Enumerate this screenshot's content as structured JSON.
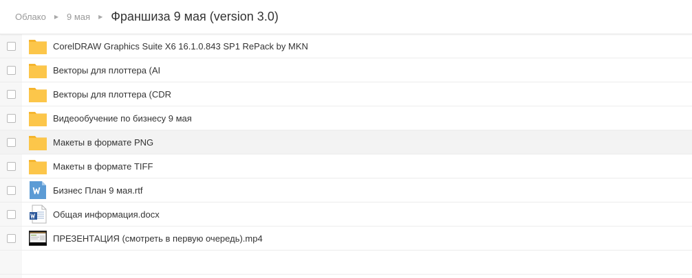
{
  "breadcrumb": {
    "items": [
      "Облако",
      "9 мая"
    ],
    "current": "Франшиза 9 мая (version 3.0)",
    "separator": "▶"
  },
  "files": [
    {
      "name": "CorelDRAW Graphics Suite X6 16.1.0.843 SP1 RePack by MKN",
      "icon": "folder-icon"
    },
    {
      "name": "Векторы для плоттера (AI",
      "icon": "folder-icon"
    },
    {
      "name": "Векторы для плоттера (CDR",
      "icon": "folder-icon"
    },
    {
      "name": "Видеообучение по бизнесу 9 мая",
      "icon": "folder-icon"
    },
    {
      "name": "Макеты в формате PNG",
      "icon": "folder-icon"
    },
    {
      "name": "Макеты в формате TIFF",
      "icon": "folder-icon"
    },
    {
      "name": "Бизнес План 9 мая.rtf",
      "icon": "rtf-file-icon"
    },
    {
      "name": "Общая информация.docx",
      "icon": "docx-file-icon"
    },
    {
      "name": "ПРЕЗЕНТАЦИЯ (смотреть в первую очередь).mp4",
      "icon": "video-thumbnail-icon"
    }
  ],
  "colors": {
    "folder": "#fcc64a",
    "folder_tab": "#f5b52e",
    "rtf": "#5b9bd5",
    "docx": "#2b579a",
    "row_hover": "#f3f3f3"
  }
}
